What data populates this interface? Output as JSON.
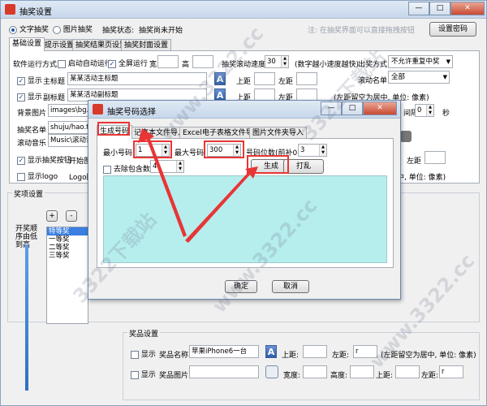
{
  "window": {
    "title": "抽奖设置",
    "buttons": {
      "minimize": "—",
      "maximize": "□",
      "close": "✕"
    }
  },
  "top": {
    "mode_text": "文字抽奖",
    "mode_image": "图片抽奖",
    "status_label": "抽奖状态:",
    "status_value": "抽奖尚未开始",
    "hint": "注: 在抽奖界面可以直接拖拽按钮",
    "password_button": "设置密码"
  },
  "main_tabs": [
    "基础设置",
    "提示设置",
    "抽奖结果页设置",
    "抽奖封面设置"
  ],
  "basic": {
    "run_mode_label": "软件运行方式",
    "auto_start": "启动自动运行",
    "fullscreen": "全屏运行",
    "width_label": "宽",
    "height_label": "高",
    "scroll_speed_label": "抽奖滚动速度",
    "scroll_speed_value": "30",
    "scroll_speed_hint": "(数字越小速度越快)",
    "exit_mode_label": "出奖方式",
    "exit_mode_value": "不允许重复中奖",
    "show1": "显示",
    "main_title_label": "主标题",
    "main_title_value": "某某活动主标题",
    "top_label": "上距",
    "left_label": "左距",
    "scroll_list_label": "滚动名单",
    "scroll_list_value": "全部",
    "show2": "显示",
    "sub_title_label": "副标题",
    "sub_title_value": "某某活动副标题",
    "center_hint": "(左距留空为居中, 单位: 像素)",
    "bg_label": "背景图片",
    "bg_value": "images\\bg.jpg",
    "interval_label": "间隔",
    "interval_value": "0",
    "sec_label": "秒",
    "list_label": "抽奖名单",
    "list_value": "shuju/hao.txt",
    "music_label": "滚动音乐",
    "music_value": "Music\\滚动音乐",
    "show_btn": "显示抽奖按钮",
    "start_img_label": "开始图片",
    "left_label2": "左距",
    "show_logo": "显示logo",
    "logo_label": "Logo图片",
    "unit_hint": "中, 单位: 像素)"
  },
  "prize": {
    "group_label": "奖项设置",
    "add": "+",
    "remove": "-",
    "order_label": "开奖顺序由低到高",
    "items": [
      "特等奖",
      "一等奖",
      "二等奖",
      "三等奖"
    ]
  },
  "goods": {
    "group_label": "奖品设置",
    "show1": "显示",
    "name_label": "奖品名称:",
    "name_value": "苹果iPhone6一台",
    "top_label": "上距:",
    "left_label": "左距:",
    "left_value": "r",
    "hint": "(左距留空为居中, 单位: 像素)",
    "show2": "显示",
    "img_label": "奖品图片:",
    "width_label": "宽度:",
    "height_label": "高度:",
    "top_label2": "上距:",
    "left_label2": "左距:",
    "left_value2": "r"
  },
  "dialog": {
    "title": "抽奖号码选择",
    "tabs": [
      "生成号码",
      "记事本文件导入",
      "Excel电子表格文件导入",
      "图片文件夹导入"
    ],
    "min_label": "最小号码:",
    "min_value": "1",
    "max_label": "最大号码:",
    "max_value": "300",
    "digits_label": "号码位数(前补0):",
    "digits_value": "3",
    "exclude_label": "去除包含数",
    "exclude_value": "4",
    "generate": "生成",
    "shuffle": "打乱",
    "ok": "确定",
    "cancel": "取消"
  },
  "watermark": "www.3322.cc",
  "watermark2": "3322下载站",
  "colors": {
    "highlight": "#e83535",
    "list_bg": "#b6eeee",
    "accent": "#1c58b5"
  }
}
